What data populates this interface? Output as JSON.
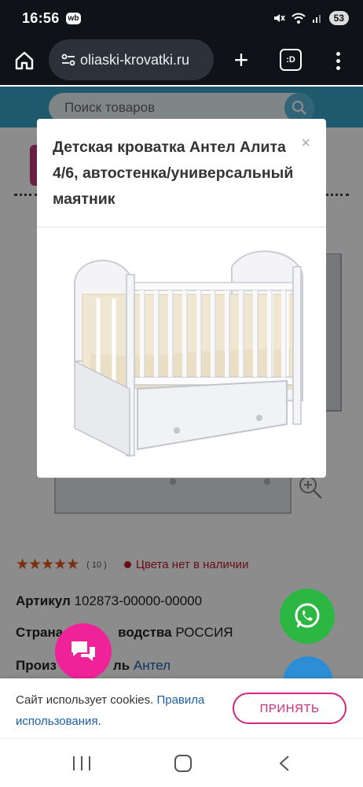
{
  "status_bar": {
    "time": "16:56",
    "app_badge": "wb",
    "battery": "53",
    "icons": [
      "mute-icon",
      "wifi-icon",
      "signal-icon"
    ]
  },
  "browser": {
    "url": "oliaski-krovatki.ru",
    "tabs_label": ":D",
    "icons": [
      "home-icon",
      "site-settings-icon",
      "new-tab-icon",
      "tabs-icon",
      "menu-icon"
    ]
  },
  "site": {
    "search_placeholder": "Поиск товаров",
    "accent_color": "#3aa2c9"
  },
  "product": {
    "rating_stars": "★★★★★",
    "rating_value": 5,
    "reviews_count": "( 10 )",
    "availability": "Цвета нет в наличии",
    "specs": {
      "article_label": "Артикул",
      "article_value": "102873-00000-00000",
      "country_label": "Страна производства",
      "country_label_visible_a": "Страна",
      "country_label_visible_b": "водства",
      "country_value": "РОССИЯ",
      "maker_label_visible_a": "Произ",
      "maker_label_visible_b": "ль",
      "maker_value": "Антел"
    }
  },
  "modal": {
    "title": "Детская кроватка Антел Алита 4/6, автостенка/универсальный маятник",
    "close_label": "×"
  },
  "cookie": {
    "text": "Сайт использует cookies.",
    "link_text_a": "Правила",
    "link_text_b": "использования",
    "link_suffix": ".",
    "accept_label": "ПРИНЯТЬ"
  },
  "colors": {
    "chat_button": "#f0229a",
    "whatsapp": "#2bb741",
    "accept_border": "#d1277f"
  }
}
